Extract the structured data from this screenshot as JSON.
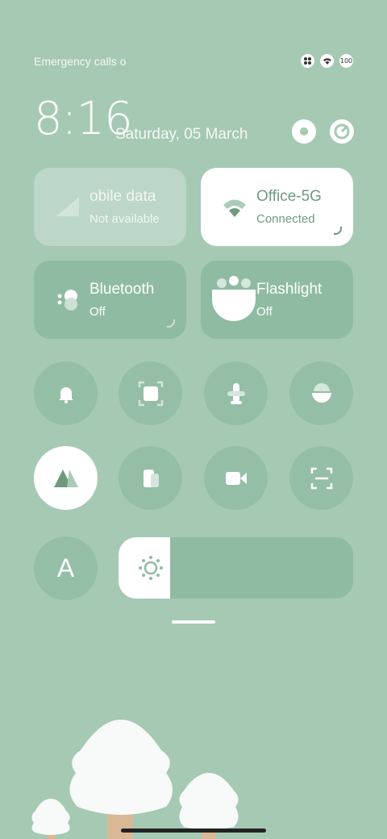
{
  "status_bar": {
    "carrier_text": "Emergency calls o",
    "battery": "100"
  },
  "clock": {
    "time": "8:16",
    "date": "Saturday, 05 March"
  },
  "tiles": {
    "mobile_data": {
      "title": "obile data",
      "subtitle": "Not available"
    },
    "wifi": {
      "title": "Office-5G",
      "subtitle": "Connected"
    },
    "bluetooth": {
      "title": "Bluetooth",
      "subtitle": "Off"
    },
    "flashlight": {
      "title": "Flashlight",
      "subtitle": "Off"
    }
  },
  "toggles_row1": [
    "bell-icon",
    "screenshot-icon",
    "airplane-icon",
    "lock-rotation-icon"
  ],
  "toggles_row2": [
    "location-icon",
    "cast-icon",
    "video-icon",
    "scanner-icon"
  ],
  "auto_brightness_label": "A",
  "brightness": {
    "level": 0.22
  },
  "colors": {
    "background": "#a6c9b4",
    "tile_active": "#ffffff",
    "accent": "#6f9a82"
  }
}
